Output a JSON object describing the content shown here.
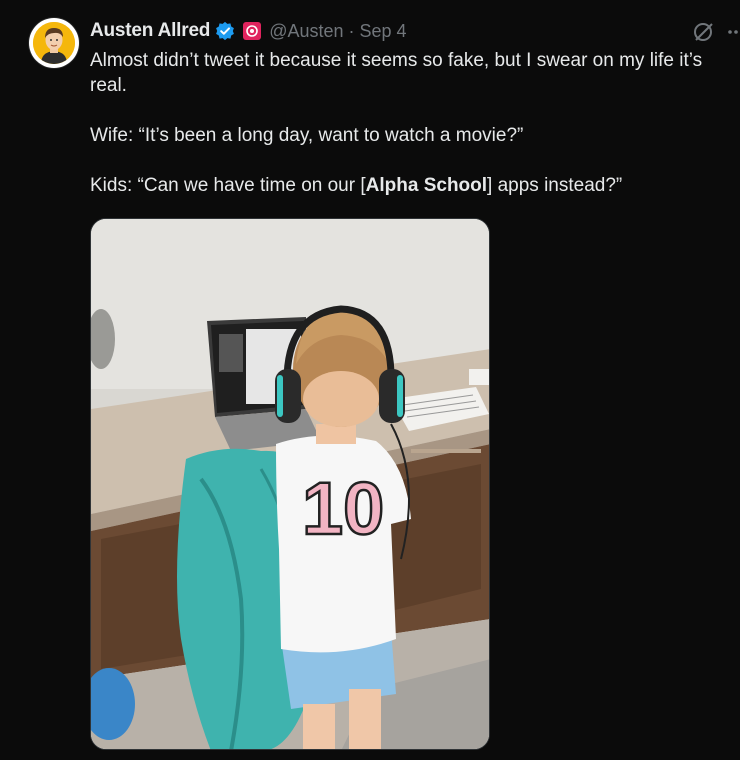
{
  "tweet": {
    "author_name": "Austen Allred",
    "handle": "@Austen",
    "separator": "·",
    "date": "Sep 4",
    "text_line1": "Almost didn’t tweet it because it seems so fake, but I swear on my life it’s real.",
    "text_wife": "Wife: “It’s been a long day, want to watch a movie?”",
    "text_kids_before": "Kids: “Can we have time on our [",
    "text_kids_bold": "Alpha School",
    "text_kids_after": "] apps instead?”"
  },
  "icons": {
    "verified": "verified-badge-icon",
    "affiliate": "affiliate-badge-icon",
    "grok": "grok-icon",
    "more": "more-icon"
  },
  "media": {
    "jersey_number": "10"
  },
  "colors": {
    "background": "#0b0b0b",
    "text": "#e7e9ea",
    "secondary": "#71767b",
    "verified": "#1d9bf0",
    "avatar_bg": "#f5b70c"
  }
}
